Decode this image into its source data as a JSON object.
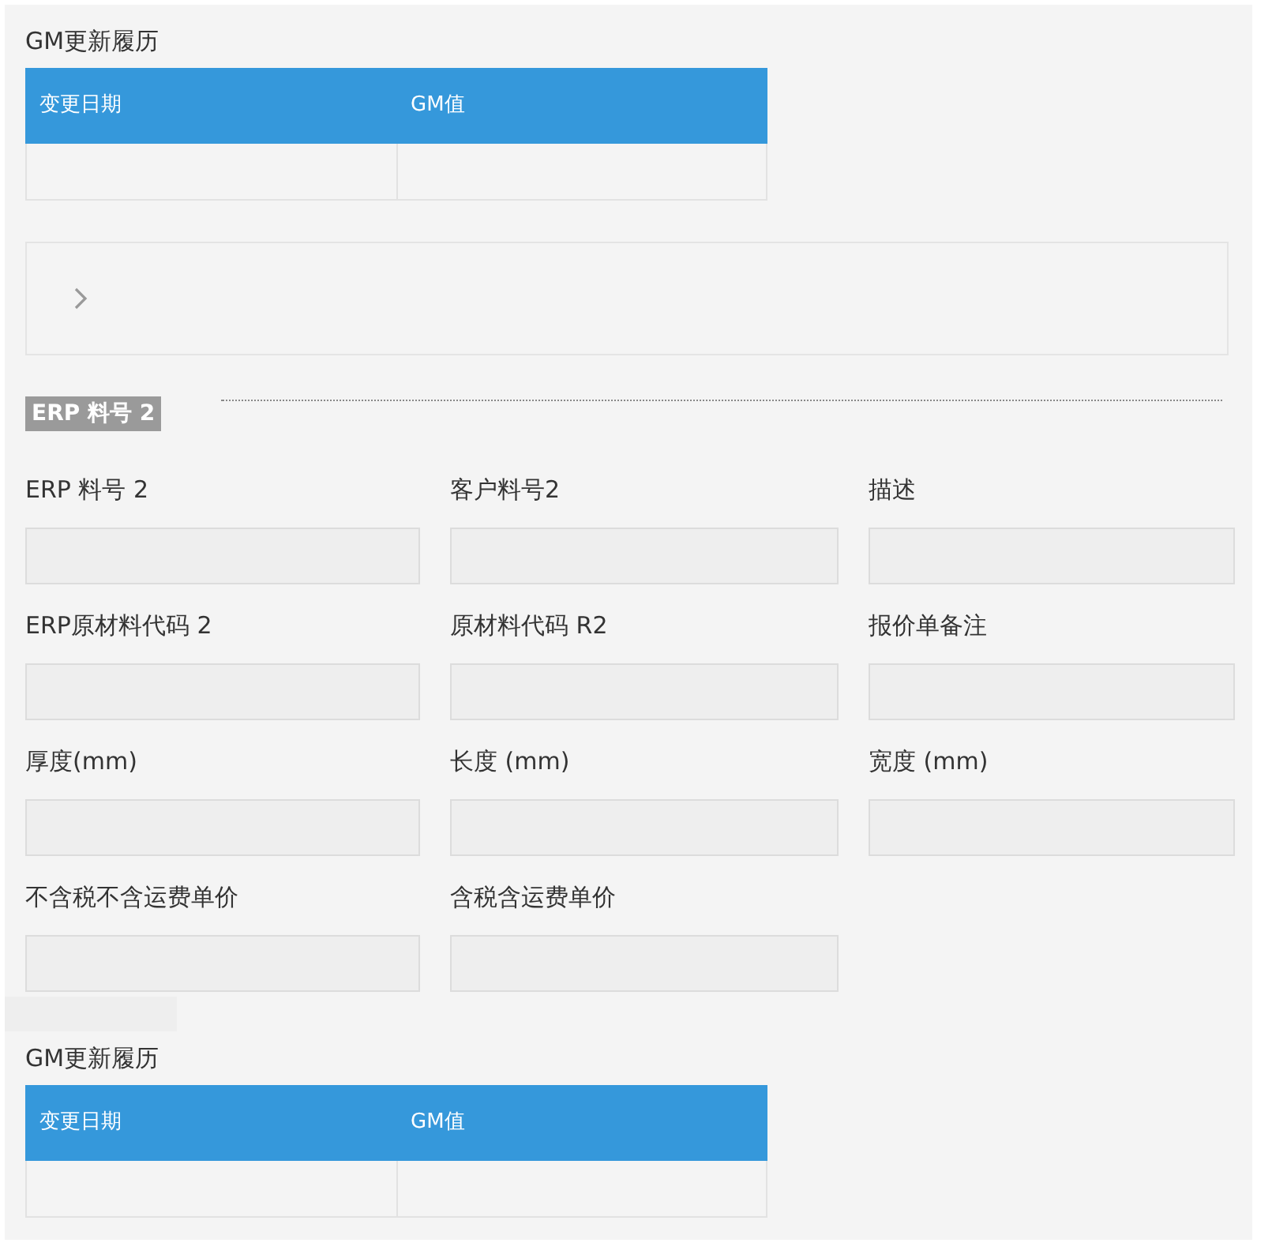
{
  "history_top": {
    "title": "GM更新履历",
    "columns": [
      "变更日期",
      "GM值"
    ]
  },
  "collapsed_panel": {
    "expanded": false
  },
  "section": {
    "title": "ERP 料号 2"
  },
  "fields": [
    {
      "label": "ERP 料号 2"
    },
    {
      "label": "客户料号2"
    },
    {
      "label": "描述"
    },
    {
      "label": "ERP原材料代码 2"
    },
    {
      "label": "原材料代码 R2"
    },
    {
      "label": "报价单备注"
    },
    {
      "label": "厚度(mm)"
    },
    {
      "label": "长度 (mm)"
    },
    {
      "label": "宽度 (mm)"
    },
    {
      "label": "不含税不含运费单价"
    },
    {
      "label": "含税含运费单价"
    }
  ],
  "history_bottom": {
    "title": "GM更新履历",
    "columns": [
      "变更日期",
      "GM值"
    ]
  }
}
